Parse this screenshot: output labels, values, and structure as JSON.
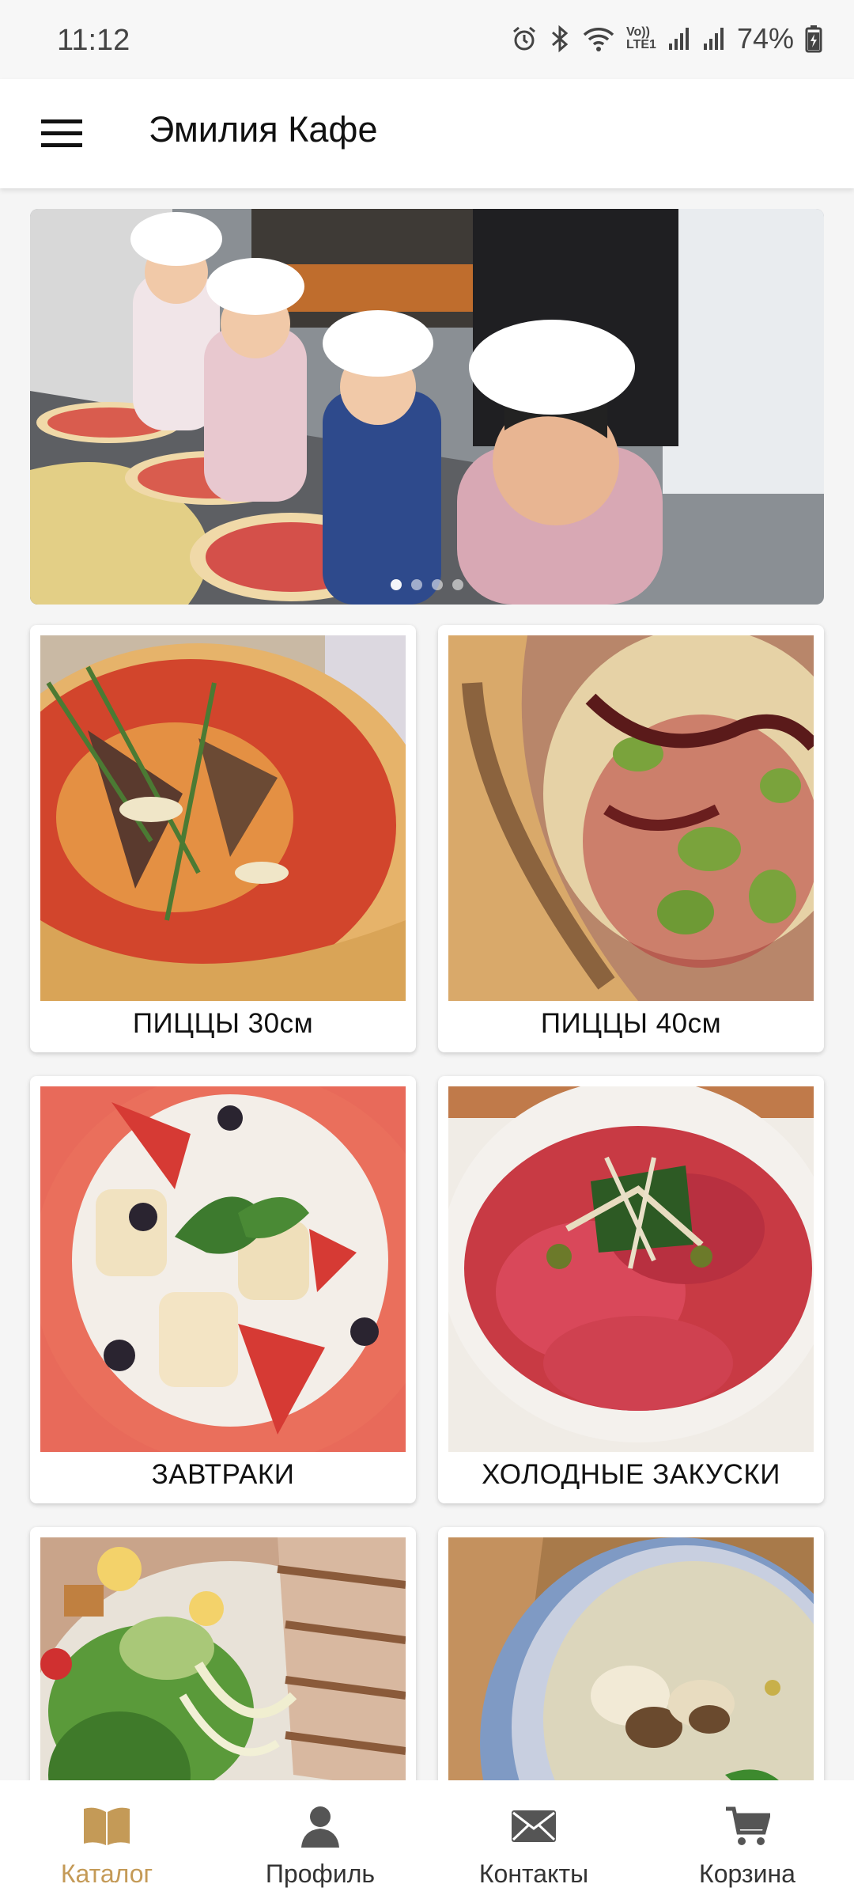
{
  "status_bar": {
    "time": "11:12",
    "battery": "74%",
    "icons": [
      "alarm-icon",
      "bluetooth-icon",
      "wifi-icon",
      "volte-icon",
      "signal-icon",
      "signal-icon",
      "battery-charging-icon"
    ],
    "volte_label": "Vo))",
    "lte_label": "LTE1"
  },
  "app_bar": {
    "title": "Эмилия Кафе",
    "menu_icon": "hamburger-menu-icon"
  },
  "banner": {
    "description_icon": "banner-image",
    "slides": 4,
    "active_slide": 1
  },
  "categories": [
    {
      "label": "ПИЦЦЫ 30см"
    },
    {
      "label": "ПИЦЦЫ 40см"
    },
    {
      "label": "ЗАВТРАКИ"
    },
    {
      "label": "ХОЛОДНЫЕ ЗАКУСКИ"
    },
    {
      "label": ""
    },
    {
      "label": ""
    }
  ],
  "bottom_nav": {
    "active_color": "#c49a57",
    "items": [
      {
        "label": "Каталог",
        "icon": "book-icon",
        "active": true
      },
      {
        "label": "Профиль",
        "icon": "person-icon",
        "active": false
      },
      {
        "label": "Контакты",
        "icon": "envelope-icon",
        "active": false
      },
      {
        "label": "Корзина",
        "icon": "cart-icon",
        "active": false
      }
    ]
  }
}
